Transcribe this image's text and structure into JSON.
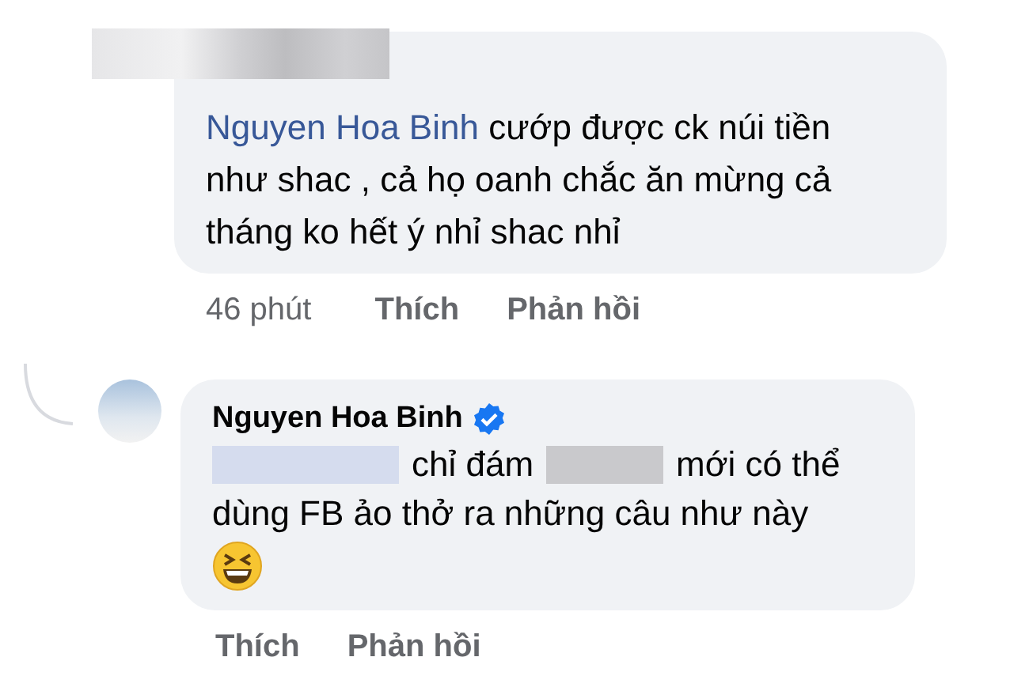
{
  "comments": [
    {
      "kind": "mention",
      "mention": "Nguyen Hoa Binh",
      "text": "cướp được ck núi tiền như shac , cả họ oanh chắc ăn mừng cả tháng ko hết ý nhỉ shac nhỉ",
      "time": "46 phút",
      "actions": [
        "Thích",
        "Phản hồi"
      ]
    },
    {
      "kind": "reply",
      "author": "Nguyen Hoa Binh",
      "verified": true,
      "lines": [
        [
          {
            "kind": "redacted",
            "color": "#d5dcee"
          },
          {
            "kind": "text",
            "text": "chỉ đám"
          },
          {
            "kind": "redacted",
            "color": "#c9c9cc"
          },
          {
            "kind": "text",
            "text": "mới có thể"
          }
        ],
        [
          {
            "kind": "text",
            "text": "dùng FB ảo thở ra những câu như này"
          }
        ]
      ],
      "actions": [
        "Thích",
        "Phản hồi"
      ]
    }
  ]
}
